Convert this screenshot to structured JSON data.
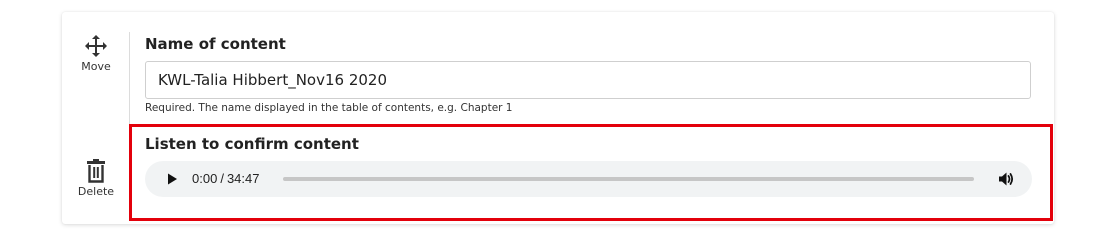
{
  "actions": {
    "move_label": "Move",
    "delete_label": "Delete"
  },
  "name_field": {
    "label": "Name of content",
    "value": "KWL-Talia Hibbert_Nov16 2020",
    "help": "Required. The name displayed in the table of contents, e.g. Chapter 1"
  },
  "listen": {
    "label": "Listen to confirm content"
  },
  "audio": {
    "current_time": "0:00",
    "separator": "/",
    "duration": "34:47",
    "progress_fraction": 0,
    "play_icon": "play-icon",
    "volume_icon": "volume-icon"
  },
  "colors": {
    "highlight": "#e3000b",
    "player_bg": "#f1f3f4",
    "track": "#c6c6c6"
  }
}
